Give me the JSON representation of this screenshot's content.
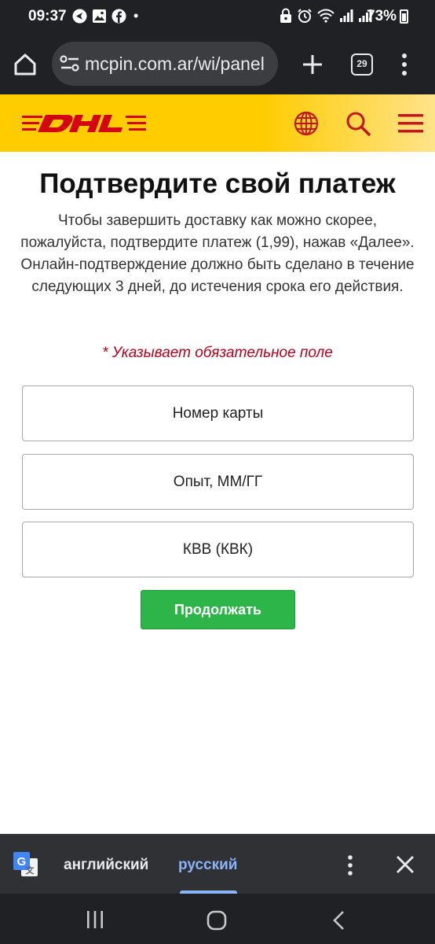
{
  "status_bar": {
    "time": "09:37",
    "dot": "•",
    "battery": "73%"
  },
  "browser": {
    "url": "mcpin.com.ar/wi/panel",
    "tab_count": "29"
  },
  "page": {
    "title": "Подтвердите свой платеж",
    "intro": "Чтобы завершить доставку как можно скорее, пожалуйста, подтвердите платеж (1,99), нажав «Далее». Онлайн-подтверждение должно быть сделано в течение следующих 3 дней, до истечения срока его действия.",
    "required_note": "* Указывает обязательное поле",
    "card_number_placeholder": "Номер карты",
    "expiry_placeholder": "Опыт, ММ/ГГ",
    "cvv_placeholder": "КВВ (КВК)",
    "continue_label": "Продолжать"
  },
  "translate_bar": {
    "source_language": "английский",
    "target_language": "русский"
  },
  "colors": {
    "dhl_yellow": "#ffcc00",
    "dhl_red": "#d40511",
    "button_green": "#2db54a",
    "required_red": "#b3001b",
    "translate_accent": "#8ab4f8"
  }
}
